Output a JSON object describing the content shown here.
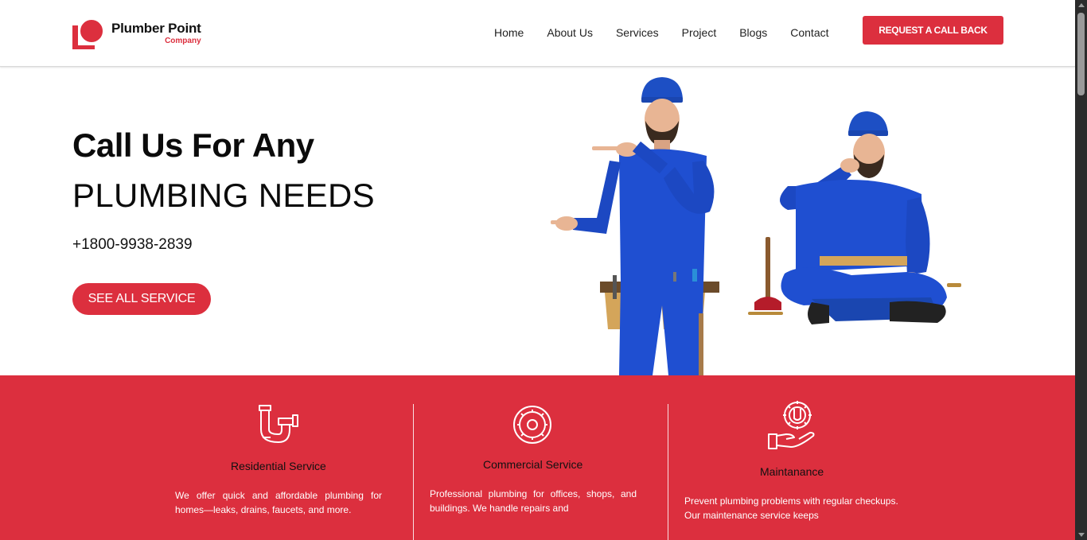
{
  "brand": {
    "name": "Plumber Point",
    "tagline": "Company",
    "accent_color": "#dc2f3e"
  },
  "nav": {
    "items": [
      {
        "label": "Home"
      },
      {
        "label": "About Us"
      },
      {
        "label": "Services"
      },
      {
        "label": "Project"
      },
      {
        "label": "Blogs"
      },
      {
        "label": "Contact"
      }
    ],
    "cta_label": "REQUEST A CALL BACK"
  },
  "hero": {
    "line1": "Call Us For Any",
    "line2": "PLUMBING NEEDS",
    "phone": "+1800-9938-2839",
    "button_label": "SEE ALL SERVICE",
    "image": "two-plumbers-in-blue-overalls-illustration"
  },
  "services": {
    "items": [
      {
        "icon": "pipe-icon",
        "title": "Residential Service",
        "description": "We offer quick and affordable plumbing for homes—leaks, drains, faucets, and more."
      },
      {
        "icon": "gear-icon",
        "title": "Commercial Service",
        "description": "Professional plumbing for offices, shops, and buildings. We handle repairs and"
      },
      {
        "icon": "hand-wrench-icon",
        "title": "Maintanance",
        "description": "Prevent plumbing problems with regular checkups. Our maintenance service keeps"
      }
    ]
  }
}
